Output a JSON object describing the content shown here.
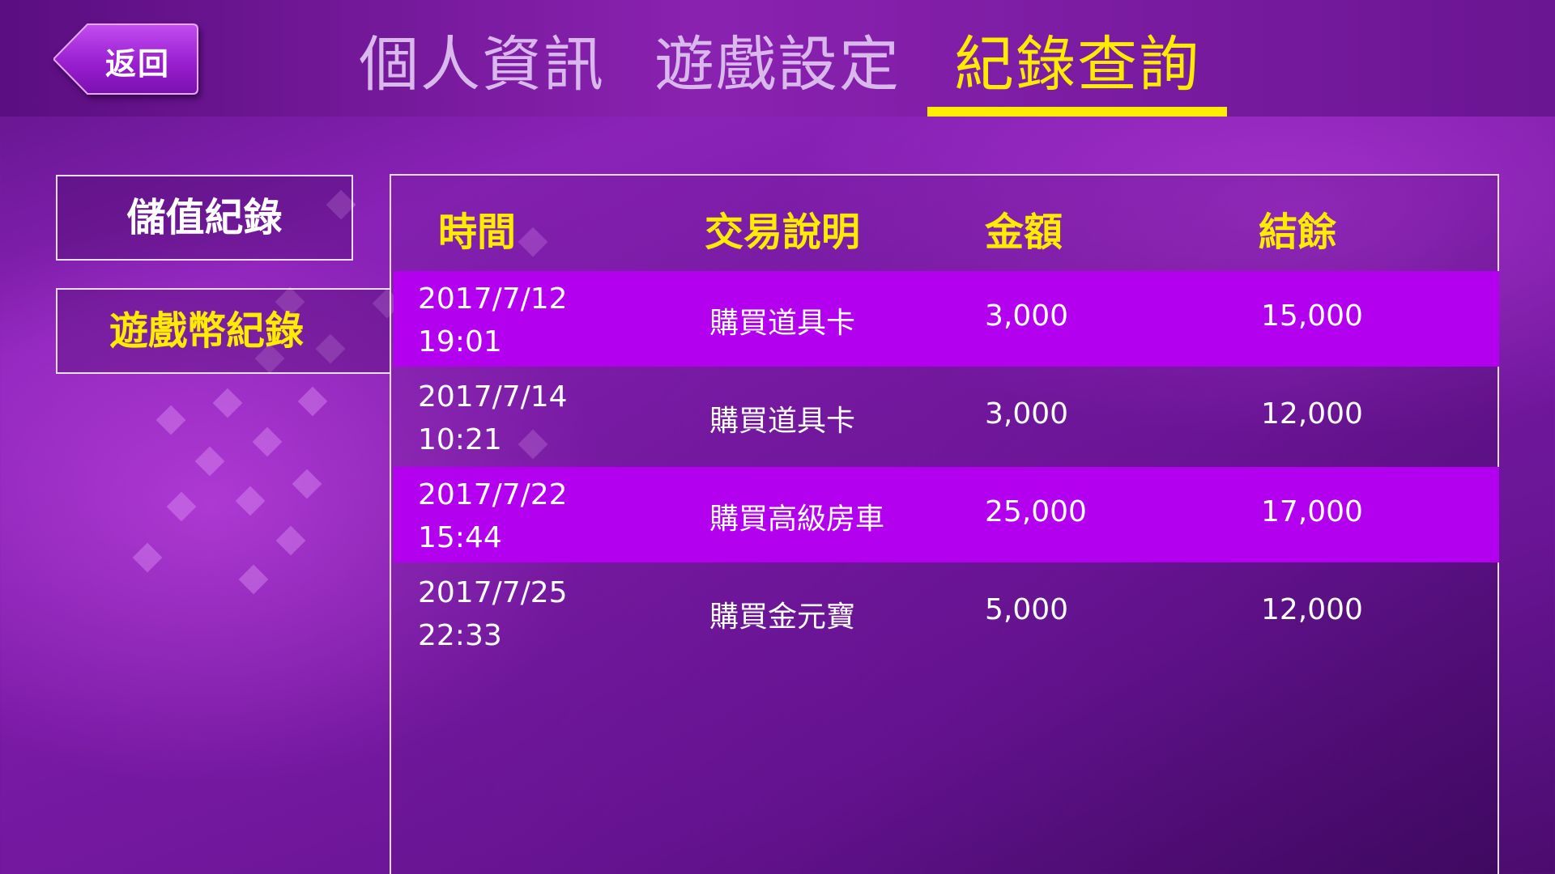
{
  "header": {
    "back_label": "返回",
    "tabs": [
      {
        "label": "個人資訊",
        "active": false
      },
      {
        "label": "遊戲設定",
        "active": false
      },
      {
        "label": "紀錄查詢",
        "active": true
      }
    ]
  },
  "sidebar": {
    "items": [
      {
        "label": "儲值紀錄",
        "active": false
      },
      {
        "label": "遊戲幣紀錄",
        "active": true
      }
    ]
  },
  "table": {
    "columns": [
      "時間",
      "交易說明",
      "金額",
      "結餘"
    ],
    "rows": [
      {
        "date": "2017/7/12",
        "time": "19:01",
        "description": "購買道具卡",
        "amount": "3,000",
        "balance": "15,000",
        "highlighted": true
      },
      {
        "date": "2017/7/14",
        "time": "10:21",
        "description": "購買道具卡",
        "amount": "3,000",
        "balance": "12,000",
        "highlighted": false
      },
      {
        "date": "2017/7/22",
        "time": "15:44",
        "description": "購買高級房車",
        "amount": "25,000",
        "balance": "17,000",
        "highlighted": true
      },
      {
        "date": "2017/7/25",
        "time": "22:33",
        "description": "購買金元寶",
        "amount": "5,000",
        "balance": "12,000",
        "highlighted": false
      }
    ]
  },
  "colors": {
    "accent_yellow": "#ffec00",
    "row_highlight": "#b300ee",
    "background_purple": "#7a1aa6"
  }
}
